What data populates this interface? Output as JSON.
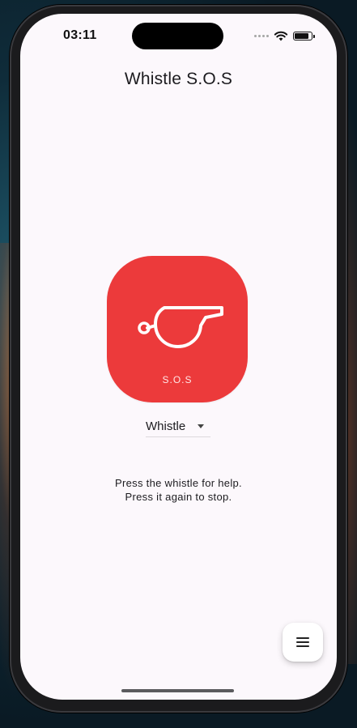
{
  "status_bar": {
    "time": "03:11",
    "battery_level": 0.9,
    "signal_icon": "signal-dots-icon",
    "wifi_icon": "wifi-icon",
    "battery_icon": "battery-icon"
  },
  "app": {
    "title": "Whistle S.O.S"
  },
  "whistle_button": {
    "label": "S.O.S",
    "icon": "whistle-icon",
    "color": "#ec3a3b"
  },
  "sound_selector": {
    "selected": "Whistle"
  },
  "instructions": {
    "line1": "Press the whistle for help.",
    "line2": "Press it again to stop."
  },
  "fab": {
    "icon": "menu-icon"
  }
}
